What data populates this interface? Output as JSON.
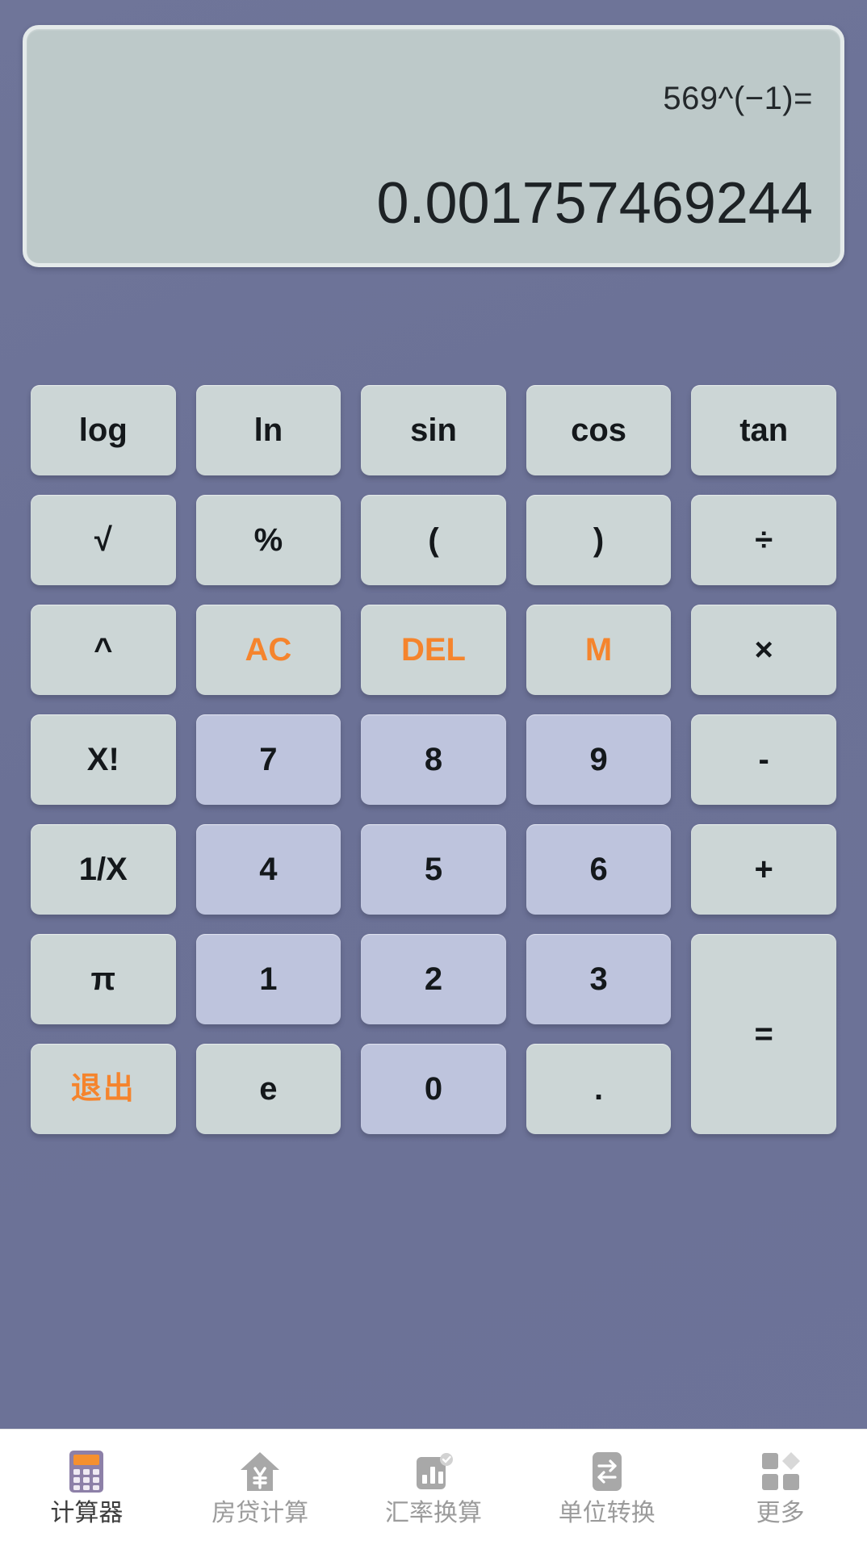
{
  "app": {
    "accent_color": "#f5842d",
    "background_color": "#6d7398",
    "display_background": "#bdc9c9",
    "function_key_color": "#ccd6d6",
    "number_key_color": "#bec4dd"
  },
  "display": {
    "expression": "569^(−1)=",
    "result": "0.001757469244"
  },
  "keypad": {
    "rows": [
      [
        {
          "label": "log",
          "name": "key-log",
          "type": "fn"
        },
        {
          "label": "ln",
          "name": "key-ln",
          "type": "fn"
        },
        {
          "label": "sin",
          "name": "key-sin",
          "type": "fn"
        },
        {
          "label": "cos",
          "name": "key-cos",
          "type": "fn"
        },
        {
          "label": "tan",
          "name": "key-tan",
          "type": "fn"
        }
      ],
      [
        {
          "label": "√",
          "name": "key-sqrt",
          "type": "fn"
        },
        {
          "label": "%",
          "name": "key-percent",
          "type": "fn"
        },
        {
          "label": "(",
          "name": "key-paren-open",
          "type": "fn"
        },
        {
          "label": ")",
          "name": "key-paren-close",
          "type": "fn"
        },
        {
          "label": "÷",
          "name": "key-divide",
          "type": "fn"
        }
      ],
      [
        {
          "label": "^",
          "name": "key-power",
          "type": "fn"
        },
        {
          "label": "AC",
          "name": "key-ac",
          "type": "fn",
          "accent": true
        },
        {
          "label": "DEL",
          "name": "key-del",
          "type": "fn",
          "accent": true
        },
        {
          "label": "M",
          "name": "key-memory",
          "type": "fn",
          "accent": true
        },
        {
          "label": "×",
          "name": "key-multiply",
          "type": "fn"
        }
      ],
      [
        {
          "label": "X!",
          "name": "key-factorial",
          "type": "fn"
        },
        {
          "label": "7",
          "name": "key-7",
          "type": "num"
        },
        {
          "label": "8",
          "name": "key-8",
          "type": "num"
        },
        {
          "label": "9",
          "name": "key-9",
          "type": "num"
        },
        {
          "label": "-",
          "name": "key-minus",
          "type": "fn"
        }
      ],
      [
        {
          "label": "1/X",
          "name": "key-reciprocal",
          "type": "fn"
        },
        {
          "label": "4",
          "name": "key-4",
          "type": "num"
        },
        {
          "label": "5",
          "name": "key-5",
          "type": "num"
        },
        {
          "label": "6",
          "name": "key-6",
          "type": "num"
        },
        {
          "label": "+",
          "name": "key-plus",
          "type": "fn"
        }
      ],
      [
        {
          "label": "π",
          "name": "key-pi",
          "type": "fn"
        },
        {
          "label": "1",
          "name": "key-1",
          "type": "num"
        },
        {
          "label": "2",
          "name": "key-2",
          "type": "num"
        },
        {
          "label": "3",
          "name": "key-3",
          "type": "num"
        },
        {
          "label": "=",
          "name": "key-equals",
          "type": "fn",
          "span2": true
        }
      ],
      [
        {
          "label": "退出",
          "name": "key-exit",
          "type": "fn",
          "accent": true,
          "cjk": true
        },
        {
          "label": "e",
          "name": "key-e",
          "type": "fn"
        },
        {
          "label": "0",
          "name": "key-0",
          "type": "num"
        },
        {
          "label": ".",
          "name": "key-decimal",
          "type": "fn"
        }
      ]
    ]
  },
  "bottom_nav": {
    "items": [
      {
        "label": "计算器",
        "name": "nav-calculator",
        "icon": "calculator-icon",
        "active": true
      },
      {
        "label": "房贷计算",
        "name": "nav-mortgage",
        "icon": "house-yen-icon",
        "active": false
      },
      {
        "label": "汇率换算",
        "name": "nav-exchange",
        "icon": "bar-chart-icon",
        "active": false
      },
      {
        "label": "单位转换",
        "name": "nav-unit",
        "icon": "swap-arrows-icon",
        "active": false
      },
      {
        "label": "更多",
        "name": "nav-more",
        "icon": "grid-icon",
        "active": false
      }
    ]
  }
}
